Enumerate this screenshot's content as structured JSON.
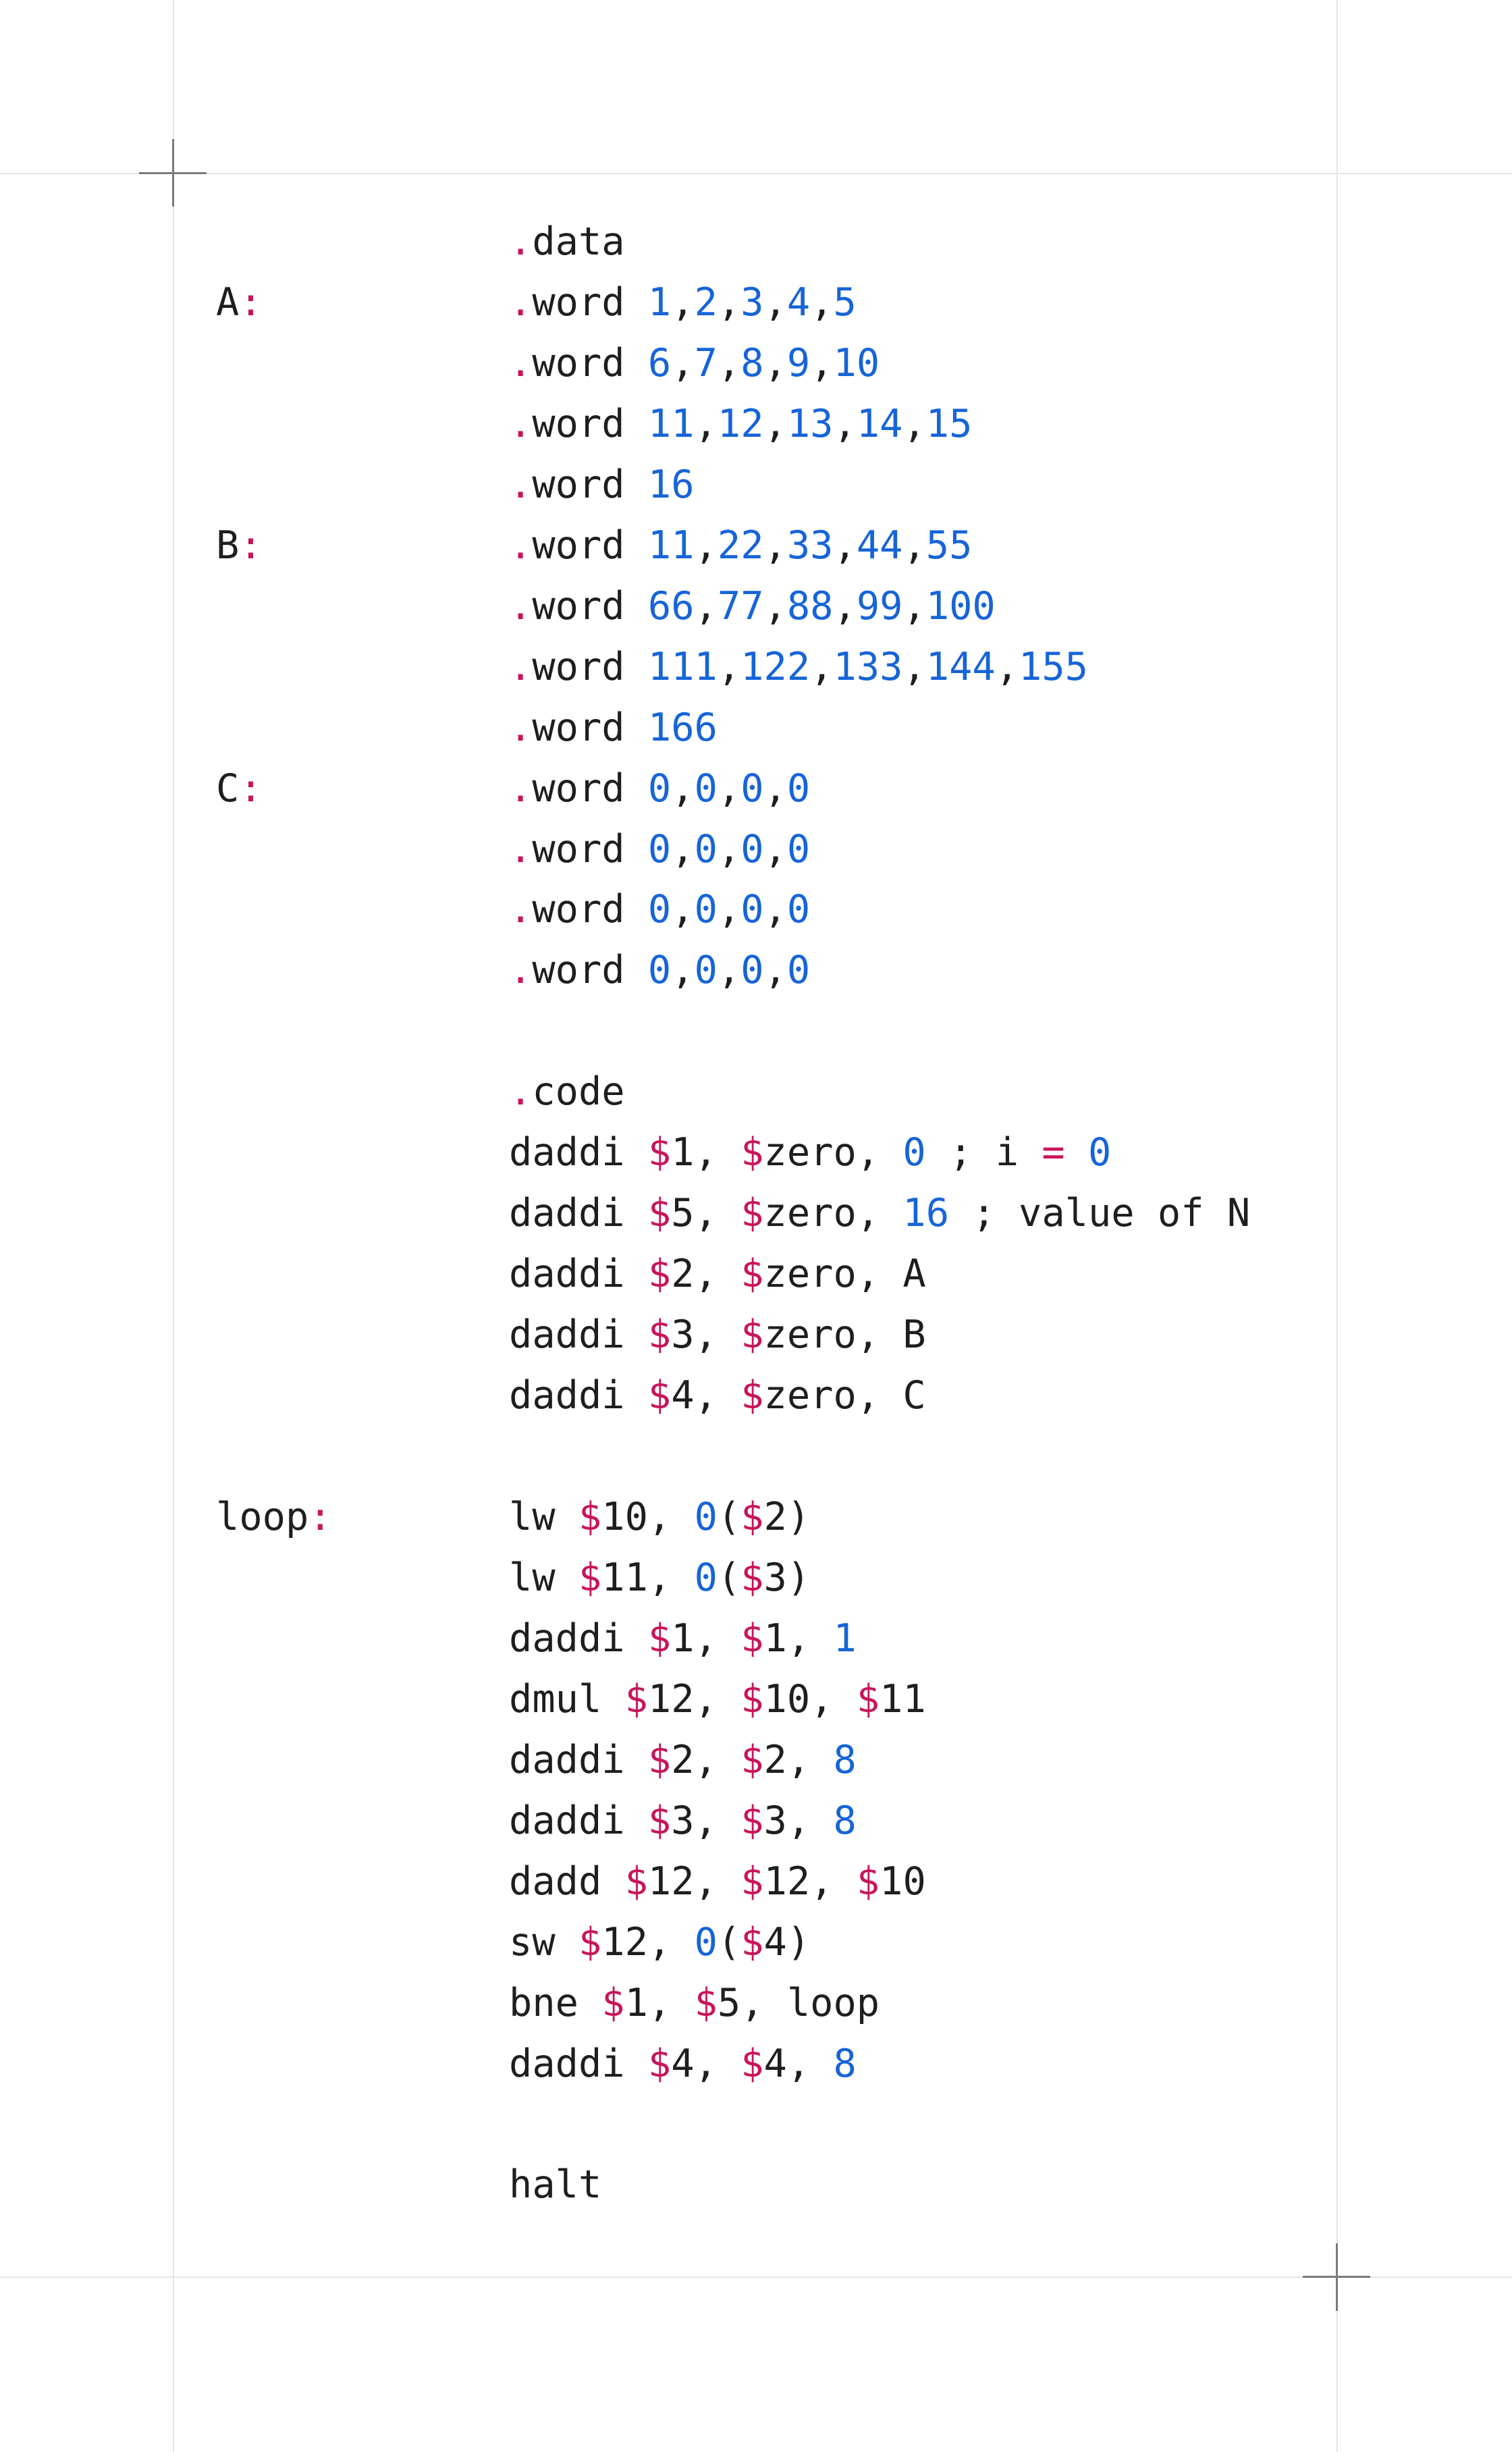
{
  "colors": {
    "text": "#1e1e1e",
    "punctuation_and_registers": "#c8145a",
    "numbers": "#1664d8",
    "guides": "#e4e4e4"
  },
  "lines": [
    {
      "label": [],
      "code": [
        {
          "t": ".",
          "c": "p"
        },
        {
          "t": "data"
        }
      ]
    },
    {
      "label": [
        {
          "t": "A"
        },
        {
          "t": ":",
          "c": "p"
        }
      ],
      "code": [
        {
          "t": ".",
          "c": "p"
        },
        {
          "t": "word "
        },
        {
          "t": "1",
          "c": "n"
        },
        {
          "t": ","
        },
        {
          "t": "2",
          "c": "n"
        },
        {
          "t": ","
        },
        {
          "t": "3",
          "c": "n"
        },
        {
          "t": ","
        },
        {
          "t": "4",
          "c": "n"
        },
        {
          "t": ","
        },
        {
          "t": "5",
          "c": "n"
        }
      ]
    },
    {
      "label": [],
      "code": [
        {
          "t": ".",
          "c": "p"
        },
        {
          "t": "word "
        },
        {
          "t": "6",
          "c": "n"
        },
        {
          "t": ","
        },
        {
          "t": "7",
          "c": "n"
        },
        {
          "t": ","
        },
        {
          "t": "8",
          "c": "n"
        },
        {
          "t": ","
        },
        {
          "t": "9",
          "c": "n"
        },
        {
          "t": ","
        },
        {
          "t": "10",
          "c": "n"
        }
      ]
    },
    {
      "label": [],
      "code": [
        {
          "t": ".",
          "c": "p"
        },
        {
          "t": "word "
        },
        {
          "t": "11",
          "c": "n"
        },
        {
          "t": ","
        },
        {
          "t": "12",
          "c": "n"
        },
        {
          "t": ","
        },
        {
          "t": "13",
          "c": "n"
        },
        {
          "t": ","
        },
        {
          "t": "14",
          "c": "n"
        },
        {
          "t": ","
        },
        {
          "t": "15",
          "c": "n"
        }
      ]
    },
    {
      "label": [],
      "code": [
        {
          "t": ".",
          "c": "p"
        },
        {
          "t": "word "
        },
        {
          "t": "16",
          "c": "n"
        }
      ]
    },
    {
      "label": [
        {
          "t": "B"
        },
        {
          "t": ":",
          "c": "p"
        }
      ],
      "code": [
        {
          "t": ".",
          "c": "p"
        },
        {
          "t": "word "
        },
        {
          "t": "11",
          "c": "n"
        },
        {
          "t": ","
        },
        {
          "t": "22",
          "c": "n"
        },
        {
          "t": ","
        },
        {
          "t": "33",
          "c": "n"
        },
        {
          "t": ","
        },
        {
          "t": "44",
          "c": "n"
        },
        {
          "t": ","
        },
        {
          "t": "55",
          "c": "n"
        }
      ]
    },
    {
      "label": [],
      "code": [
        {
          "t": ".",
          "c": "p"
        },
        {
          "t": "word "
        },
        {
          "t": "66",
          "c": "n"
        },
        {
          "t": ","
        },
        {
          "t": "77",
          "c": "n"
        },
        {
          "t": ","
        },
        {
          "t": "88",
          "c": "n"
        },
        {
          "t": ","
        },
        {
          "t": "99",
          "c": "n"
        },
        {
          "t": ","
        },
        {
          "t": "100",
          "c": "n"
        }
      ]
    },
    {
      "label": [],
      "code": [
        {
          "t": ".",
          "c": "p"
        },
        {
          "t": "word "
        },
        {
          "t": "111",
          "c": "n"
        },
        {
          "t": ","
        },
        {
          "t": "122",
          "c": "n"
        },
        {
          "t": ","
        },
        {
          "t": "133",
          "c": "n"
        },
        {
          "t": ","
        },
        {
          "t": "144",
          "c": "n"
        },
        {
          "t": ","
        },
        {
          "t": "155",
          "c": "n"
        }
      ]
    },
    {
      "label": [],
      "code": [
        {
          "t": ".",
          "c": "p"
        },
        {
          "t": "word "
        },
        {
          "t": "166",
          "c": "n"
        }
      ]
    },
    {
      "label": [
        {
          "t": "C"
        },
        {
          "t": ":",
          "c": "p"
        }
      ],
      "code": [
        {
          "t": ".",
          "c": "p"
        },
        {
          "t": "word "
        },
        {
          "t": "0",
          "c": "n"
        },
        {
          "t": ","
        },
        {
          "t": "0",
          "c": "n"
        },
        {
          "t": ","
        },
        {
          "t": "0",
          "c": "n"
        },
        {
          "t": ","
        },
        {
          "t": "0",
          "c": "n"
        }
      ]
    },
    {
      "label": [],
      "code": [
        {
          "t": ".",
          "c": "p"
        },
        {
          "t": "word "
        },
        {
          "t": "0",
          "c": "n"
        },
        {
          "t": ","
        },
        {
          "t": "0",
          "c": "n"
        },
        {
          "t": ","
        },
        {
          "t": "0",
          "c": "n"
        },
        {
          "t": ","
        },
        {
          "t": "0",
          "c": "n"
        }
      ]
    },
    {
      "label": [],
      "code": [
        {
          "t": ".",
          "c": "p"
        },
        {
          "t": "word "
        },
        {
          "t": "0",
          "c": "n"
        },
        {
          "t": ","
        },
        {
          "t": "0",
          "c": "n"
        },
        {
          "t": ","
        },
        {
          "t": "0",
          "c": "n"
        },
        {
          "t": ","
        },
        {
          "t": "0",
          "c": "n"
        }
      ]
    },
    {
      "label": [],
      "code": [
        {
          "t": ".",
          "c": "p"
        },
        {
          "t": "word "
        },
        {
          "t": "0",
          "c": "n"
        },
        {
          "t": ","
        },
        {
          "t": "0",
          "c": "n"
        },
        {
          "t": ","
        },
        {
          "t": "0",
          "c": "n"
        },
        {
          "t": ","
        },
        {
          "t": "0",
          "c": "n"
        }
      ]
    },
    {
      "label": [],
      "code": []
    },
    {
      "label": [],
      "code": [
        {
          "t": ".",
          "c": "p"
        },
        {
          "t": "code"
        }
      ]
    },
    {
      "label": [],
      "code": [
        {
          "t": "daddi "
        },
        {
          "t": "$",
          "c": "p"
        },
        {
          "t": "1, "
        },
        {
          "t": "$",
          "c": "p"
        },
        {
          "t": "zero, "
        },
        {
          "t": "0",
          "c": "n"
        },
        {
          "t": " ; i "
        },
        {
          "t": "=",
          "c": "p"
        },
        {
          "t": " "
        },
        {
          "t": "0",
          "c": "n"
        }
      ]
    },
    {
      "label": [],
      "code": [
        {
          "t": "daddi "
        },
        {
          "t": "$",
          "c": "p"
        },
        {
          "t": "5, "
        },
        {
          "t": "$",
          "c": "p"
        },
        {
          "t": "zero, "
        },
        {
          "t": "16",
          "c": "n"
        },
        {
          "t": " ; value of N"
        }
      ]
    },
    {
      "label": [],
      "code": [
        {
          "t": "daddi "
        },
        {
          "t": "$",
          "c": "p"
        },
        {
          "t": "2, "
        },
        {
          "t": "$",
          "c": "p"
        },
        {
          "t": "zero, A"
        }
      ]
    },
    {
      "label": [],
      "code": [
        {
          "t": "daddi "
        },
        {
          "t": "$",
          "c": "p"
        },
        {
          "t": "3, "
        },
        {
          "t": "$",
          "c": "p"
        },
        {
          "t": "zero, B"
        }
      ]
    },
    {
      "label": [],
      "code": [
        {
          "t": "daddi "
        },
        {
          "t": "$",
          "c": "p"
        },
        {
          "t": "4, "
        },
        {
          "t": "$",
          "c": "p"
        },
        {
          "t": "zero, C"
        }
      ]
    },
    {
      "label": [],
      "code": []
    },
    {
      "label": [
        {
          "t": "loop"
        },
        {
          "t": ":",
          "c": "p"
        }
      ],
      "code": [
        {
          "t": "lw "
        },
        {
          "t": "$",
          "c": "p"
        },
        {
          "t": "10, "
        },
        {
          "t": "0",
          "c": "n"
        },
        {
          "t": "("
        },
        {
          "t": "$",
          "c": "p"
        },
        {
          "t": "2)"
        }
      ]
    },
    {
      "label": [],
      "code": [
        {
          "t": "lw "
        },
        {
          "t": "$",
          "c": "p"
        },
        {
          "t": "11, "
        },
        {
          "t": "0",
          "c": "n"
        },
        {
          "t": "("
        },
        {
          "t": "$",
          "c": "p"
        },
        {
          "t": "3)"
        }
      ]
    },
    {
      "label": [],
      "code": [
        {
          "t": "daddi "
        },
        {
          "t": "$",
          "c": "p"
        },
        {
          "t": "1, "
        },
        {
          "t": "$",
          "c": "p"
        },
        {
          "t": "1, "
        },
        {
          "t": "1",
          "c": "n"
        }
      ]
    },
    {
      "label": [],
      "code": [
        {
          "t": "dmul "
        },
        {
          "t": "$",
          "c": "p"
        },
        {
          "t": "12, "
        },
        {
          "t": "$",
          "c": "p"
        },
        {
          "t": "10, "
        },
        {
          "t": "$",
          "c": "p"
        },
        {
          "t": "11"
        }
      ]
    },
    {
      "label": [],
      "code": [
        {
          "t": "daddi "
        },
        {
          "t": "$",
          "c": "p"
        },
        {
          "t": "2, "
        },
        {
          "t": "$",
          "c": "p"
        },
        {
          "t": "2, "
        },
        {
          "t": "8",
          "c": "n"
        }
      ]
    },
    {
      "label": [],
      "code": [
        {
          "t": "daddi "
        },
        {
          "t": "$",
          "c": "p"
        },
        {
          "t": "3, "
        },
        {
          "t": "$",
          "c": "p"
        },
        {
          "t": "3, "
        },
        {
          "t": "8",
          "c": "n"
        }
      ]
    },
    {
      "label": [],
      "code": [
        {
          "t": "dadd "
        },
        {
          "t": "$",
          "c": "p"
        },
        {
          "t": "12, "
        },
        {
          "t": "$",
          "c": "p"
        },
        {
          "t": "12, "
        },
        {
          "t": "$",
          "c": "p"
        },
        {
          "t": "10"
        }
      ]
    },
    {
      "label": [],
      "code": [
        {
          "t": "sw "
        },
        {
          "t": "$",
          "c": "p"
        },
        {
          "t": "12, "
        },
        {
          "t": "0",
          "c": "n"
        },
        {
          "t": "("
        },
        {
          "t": "$",
          "c": "p"
        },
        {
          "t": "4)"
        }
      ]
    },
    {
      "label": [],
      "code": [
        {
          "t": "bne "
        },
        {
          "t": "$",
          "c": "p"
        },
        {
          "t": "1, "
        },
        {
          "t": "$",
          "c": "p"
        },
        {
          "t": "5, loop"
        }
      ]
    },
    {
      "label": [],
      "code": [
        {
          "t": "daddi "
        },
        {
          "t": "$",
          "c": "p"
        },
        {
          "t": "4, "
        },
        {
          "t": "$",
          "c": "p"
        },
        {
          "t": "4, "
        },
        {
          "t": "8",
          "c": "n"
        }
      ]
    },
    {
      "label": [],
      "code": []
    },
    {
      "label": [],
      "code": [
        {
          "t": "halt"
        }
      ]
    }
  ]
}
